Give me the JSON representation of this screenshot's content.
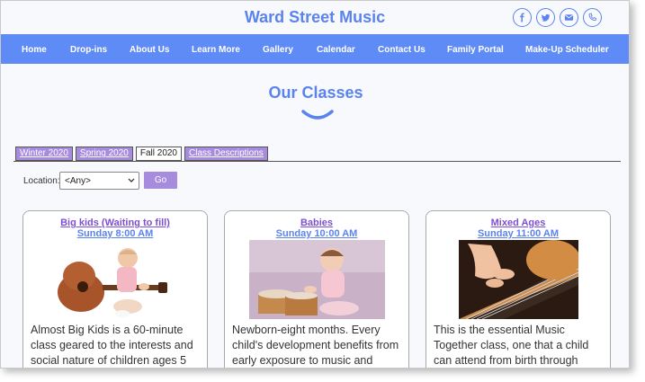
{
  "header": {
    "site_title": "Ward Street Music",
    "social_icons": [
      "facebook-icon",
      "twitter-icon",
      "envelope-icon",
      "phone-icon"
    ],
    "accent_color": "#5a83f0"
  },
  "nav": {
    "items": [
      "Home",
      "Drop-ins",
      "About Us",
      "Learn More",
      "Gallery",
      "Calendar",
      "Contact Us",
      "Family Portal",
      "Make-Up Scheduler"
    ],
    "background": "#5f8bf6"
  },
  "main": {
    "title": "Our Classes",
    "tabs": [
      {
        "label": "Winter 2020",
        "state": "link"
      },
      {
        "label": "Spring 2020",
        "state": "link"
      },
      {
        "label": "Fall 2020",
        "state": "active"
      },
      {
        "label": "Class Descriptions",
        "state": "link"
      }
    ],
    "filter": {
      "location_label": "Location:",
      "location_value": "<Any>",
      "go_label": "Go"
    },
    "cards": [
      {
        "title": "Big kids (Waiting to fill)",
        "time": "Sunday 8:00 AM",
        "image": "baby-with-guitar",
        "description": "Almost Big Kids is a 60-minute class geared to the interests and social nature of children ages 5"
      },
      {
        "title": "Babies",
        "time": "Sunday 10:00 AM",
        "image": "baby-with-drums",
        "description": "Newborn-eight months. Every child's development benefits from early exposure to music and"
      },
      {
        "title": "Mixed Ages",
        "time": "Sunday 11:00 AM",
        "image": "child-hand-on-guitar",
        "description": "This is the essential Music Together class, one that a child can attend from birth through"
      }
    ]
  }
}
